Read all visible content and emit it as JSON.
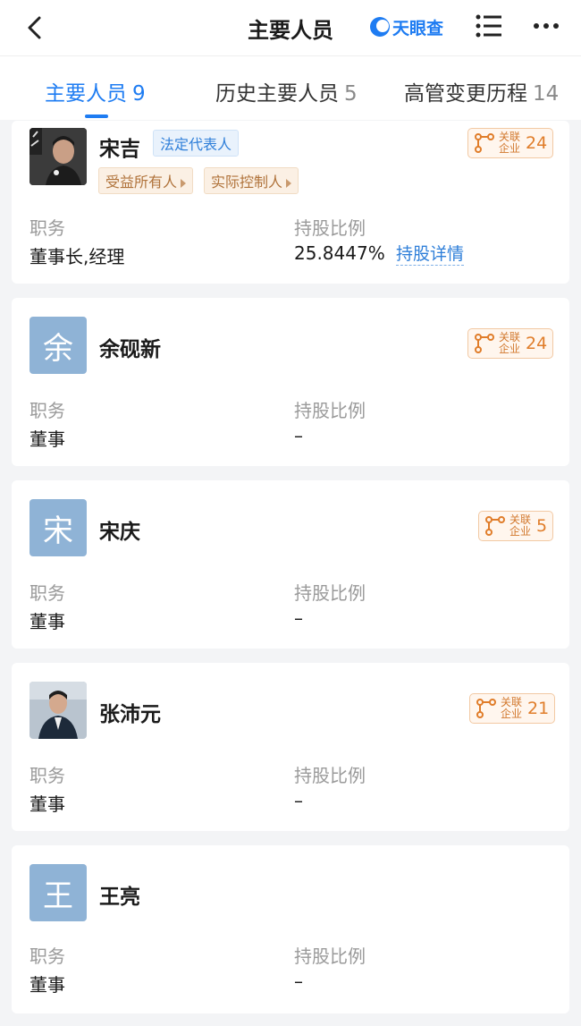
{
  "header": {
    "title": "主要人员",
    "brand": "天眼查"
  },
  "tabs": [
    {
      "label": "主要人员",
      "count": "9"
    },
    {
      "label": "历史主要人员",
      "count": "5"
    },
    {
      "label": "高管变更历程",
      "count": "14"
    }
  ],
  "labels": {
    "position": "职务",
    "share_ratio": "持股比例",
    "related": "关联企业"
  },
  "people": [
    {
      "name": "宋吉",
      "tags": {
        "legal": "法定代表人",
        "beneficiary": "受益所有人",
        "controller": "实际控制人"
      },
      "related_count": "24",
      "position": "董事长,经理",
      "share": "25.8447%",
      "share_link": "持股详情"
    },
    {
      "name": "余砚新",
      "avatar_letter": "余",
      "related_count": "24",
      "position": "董事",
      "share": "–"
    },
    {
      "name": "宋庆",
      "avatar_letter": "宋",
      "related_count": "5",
      "position": "董事",
      "share": "–"
    },
    {
      "name": "张沛元",
      "related_count": "21",
      "position": "董事",
      "share": "–"
    },
    {
      "name": "王亮",
      "avatar_letter": "王",
      "position": "董事",
      "share": "–"
    }
  ],
  "colors": {
    "accent": "#1e7cf2",
    "related_orange": "#e07d2a",
    "avatar_bg": "#8fb3d6"
  }
}
